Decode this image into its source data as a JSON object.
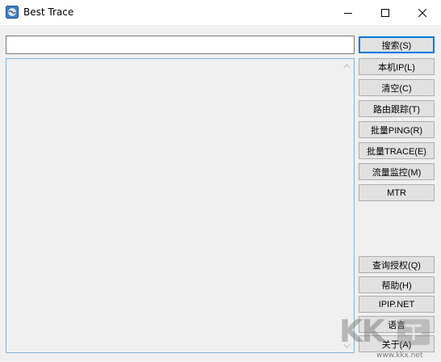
{
  "window": {
    "title": "Best Trace",
    "icon": "best-trace-app-icon"
  },
  "caption_buttons": {
    "minimize_icon": "minimize-icon",
    "maximize_icon": "maximize-icon",
    "close_icon": "close-icon"
  },
  "search": {
    "value": "",
    "placeholder": ""
  },
  "result_area": {
    "content": "",
    "scroll_up_icon": "scroll-up-arrow-icon",
    "scroll_down_icon": "scroll-down-arrow-icon"
  },
  "buttons": {
    "search": "搜索(S)",
    "local_ip": "本机IP(L)",
    "clear": "清空(C)",
    "route_trace": "路由跟踪(T)",
    "batch_ping": "批量PING(R)",
    "batch_trace": "批量TRACE(E)",
    "traffic_monitor": "流量监控(M)",
    "mtr": "MTR",
    "query_license": "查询授权(Q)",
    "help": "帮助(H)",
    "ipip": "IPIP.NET",
    "language": "语言",
    "about": "关于(A)"
  },
  "watermark": {
    "logo_text": "KK",
    "url": "www.kkx.net"
  },
  "colors": {
    "focus_border": "#0078d7",
    "list_border": "#82b4d9",
    "button_face": "#e1e1e1",
    "window_bg": "#f0f0f0"
  }
}
